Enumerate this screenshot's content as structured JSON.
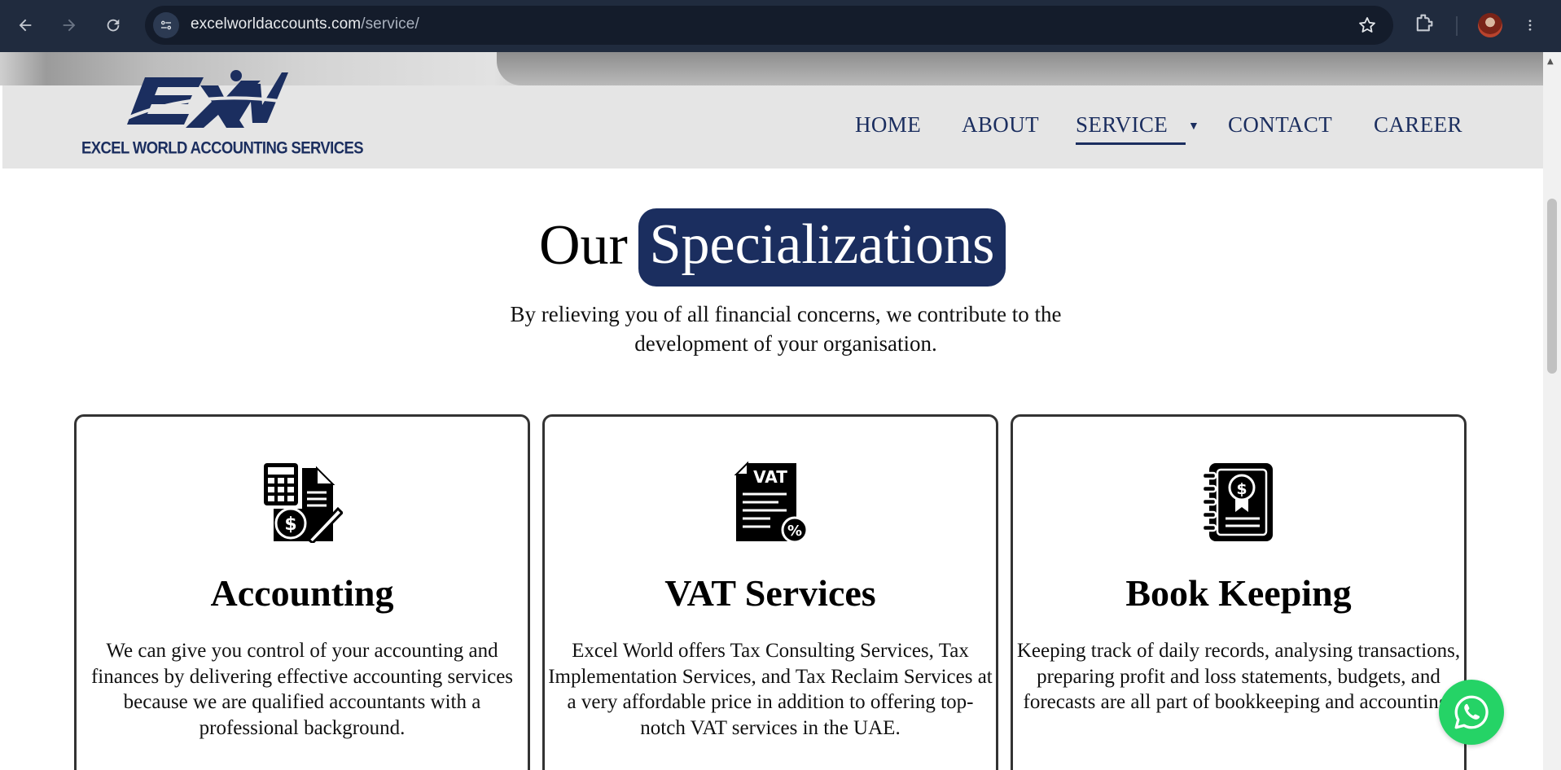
{
  "browser": {
    "url_host": "excelworldaccounts.com",
    "url_path": "/service/",
    "icons": [
      "back-arrow-icon",
      "forward-arrow-icon",
      "reload-icon",
      "site-info-icon",
      "bookmark-star-icon",
      "extensions-icon",
      "profile-avatar",
      "kebab-menu-icon"
    ]
  },
  "header": {
    "logo_text": "EXCEL WORLD ACCOUNTING SERVICES",
    "nav": {
      "home": "HOME",
      "about": "ABOUT",
      "service": "SERVICE",
      "contact": "CONTACT",
      "career": "CAREER"
    },
    "active_item": "SERVICE"
  },
  "section": {
    "title_plain": "Our",
    "title_highlight": "Specializations",
    "subtitle": "By relieving you of all financial concerns, we contribute to the development of your organisation."
  },
  "cards": [
    {
      "icon": "calculator-invoice-icon",
      "title": "Accounting",
      "text": "We can give you control of your accounting and finances by delivering effective accounting services because we are qualified accountants with a professional background."
    },
    {
      "icon": "vat-document-icon",
      "title": "VAT Services",
      "text": "Excel World offers Tax Consulting Services, Tax Implementation Services, and Tax Reclaim Services at a very affordable price in addition to offering top-notch VAT services in the UAE."
    },
    {
      "icon": "ledger-book-icon",
      "title": "Book Keeping",
      "text": "Keeping track of daily records, analysing transactions, preparing profit and loss statements, budgets, and forecasts are all part of bookkeeping and accounting."
    }
  ],
  "colors": {
    "brand_navy": "#1b2e5f",
    "header_bg": "#e5e5e5",
    "whatsapp_green": "#25d366",
    "chrome_bg": "#202b3e"
  }
}
